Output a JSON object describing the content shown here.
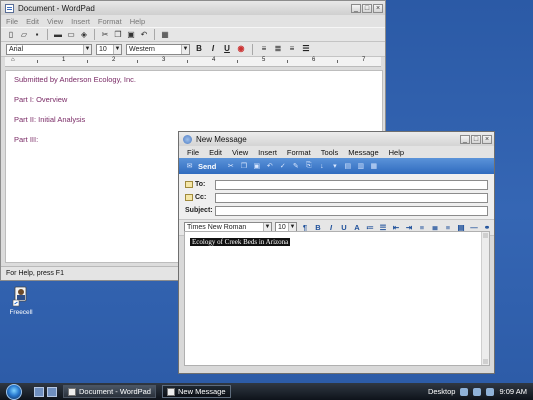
{
  "wordpad": {
    "title": "Document - WordPad",
    "menu": [
      "File",
      "Edit",
      "View",
      "Insert",
      "Format",
      "Help"
    ],
    "font": "Arial",
    "size": "10",
    "script": "Western",
    "ruler_numbers": [
      "1",
      "2",
      "3",
      "4",
      "5",
      "6",
      "7"
    ],
    "doc_lines": [
      "Submitted by Anderson Ecology, Inc.",
      "Part I: Overview",
      "Part II: Initial Analysis",
      "Part III:"
    ],
    "status": "For Help, press F1"
  },
  "desktop_icon": {
    "label": "Freecell"
  },
  "new_message": {
    "title": "New Message",
    "menu": [
      "File",
      "Edit",
      "View",
      "Insert",
      "Format",
      "Tools",
      "Message",
      "Help"
    ],
    "send_label": "Send",
    "to_label": "To:",
    "cc_label": "Cc:",
    "subject_label": "Subject:",
    "font": "Times New Roman",
    "size": "10",
    "body_selected_text": "Ecology of Creek Beds in Arizona"
  },
  "taskbar": {
    "tasks": [
      "Document - WordPad",
      "New Message"
    ],
    "desktop_label": "Desktop",
    "time": "9:09 AM"
  },
  "colors": {
    "desktop": "#2f5ea8",
    "doc_text": "#7a2b66",
    "send_bar": "#2f6bbf"
  }
}
